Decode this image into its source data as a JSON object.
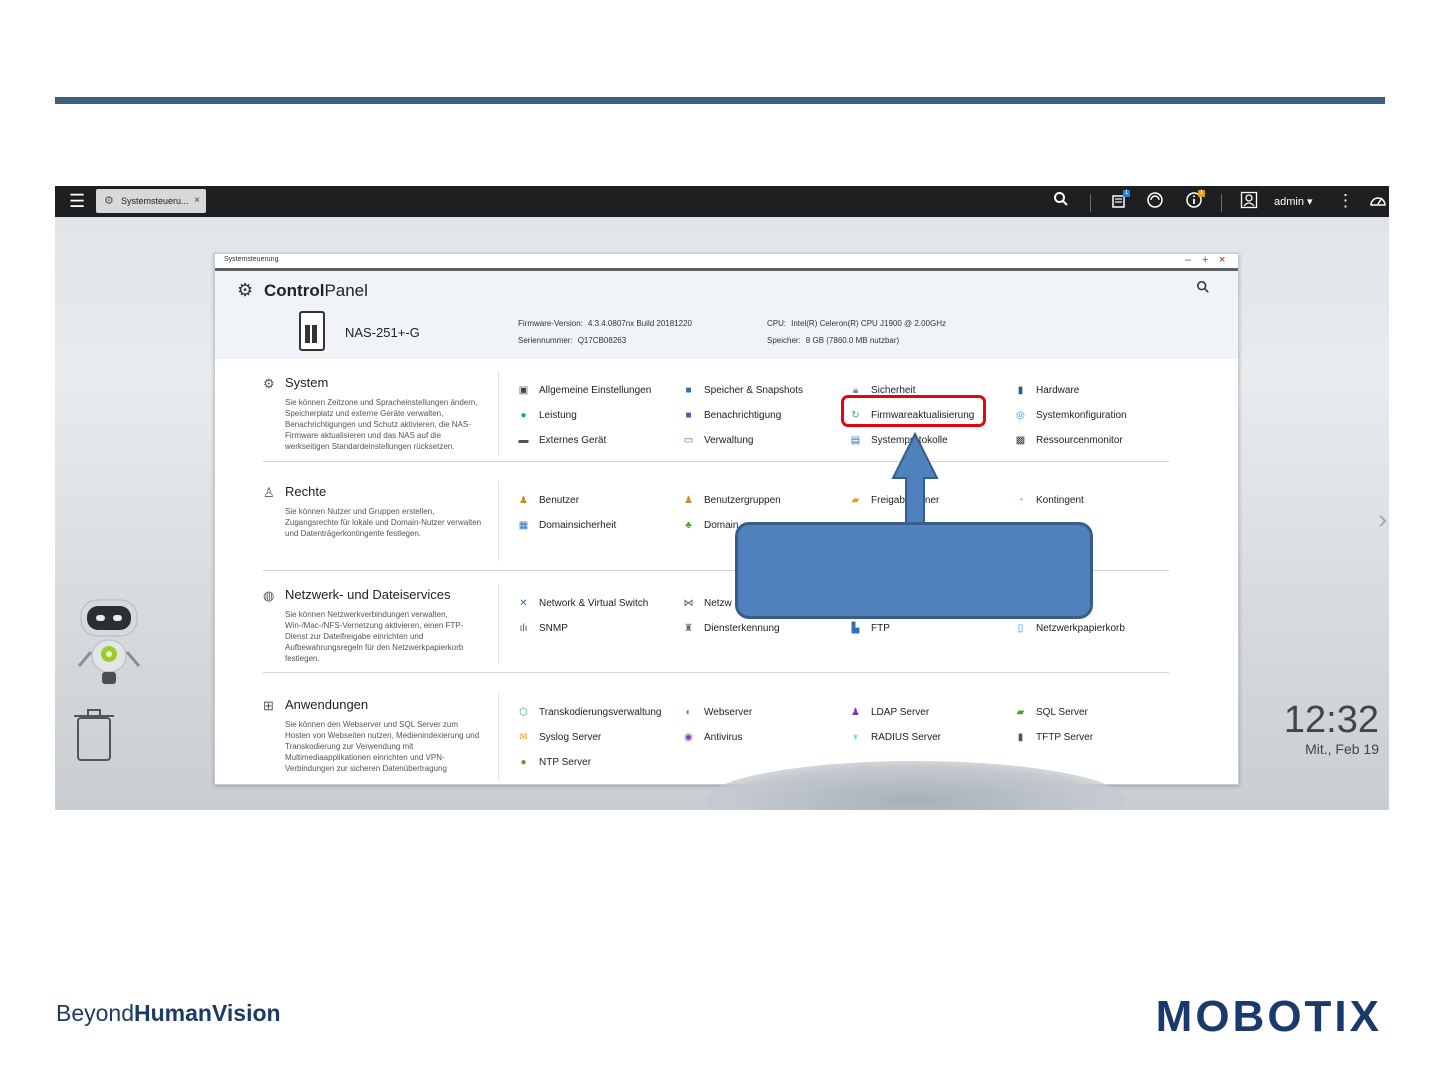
{
  "taskbar": {
    "tab_label": "Systemsteueru...",
    "tab_close": "×",
    "badge_notify": "1",
    "badge_info": "1",
    "user": "admin ▾"
  },
  "desktop": {
    "time": "12:32",
    "date": "Mit., Feb 19"
  },
  "window": {
    "title": "Systemsteuerung",
    "controls": [
      "–",
      "+",
      "×"
    ],
    "app_title_bold": "Control",
    "app_title_light": "Panel",
    "device_name": "NAS-251+-G",
    "specs": {
      "firmware_label": "Firmware-Version:",
      "firmware_value": "4.3.4.0807nx Build 20181220",
      "serial_label": "Seriennummer:",
      "serial_value": "Q17CB08263",
      "cpu_label": "CPU:",
      "cpu_value": "Intel(R) Celeron(R) CPU J1900 @ 2.00GHz",
      "memory_label": "Speicher:",
      "memory_value": "8 GB (7860.0 MB nutzbar)"
    }
  },
  "sections": [
    {
      "title": "System",
      "icon": "gear-icon",
      "description": "Sie können Zeitzone und Spracheinstellungen ändern, Speicherplatz und externe Geräte verwalten, Benachrichtigungen und Schutz aktivieren, die NAS-Firmware aktualisieren und das NAS auf die werkseitigen Standardeinstellungen rücksetzen.",
      "items": [
        {
          "label": "Allgemeine Einstellungen",
          "icon": "settings-doc-icon",
          "color": "#444"
        },
        {
          "label": "Speicher & Snapshots",
          "icon": "storage-icon",
          "color": "#2f6fb8"
        },
        {
          "label": "Sicherheit",
          "icon": "lock-icon",
          "color": "#888"
        },
        {
          "label": "Hardware",
          "icon": "hardware-icon",
          "color": "#2a5a8a"
        },
        {
          "label": "Leistung",
          "icon": "lightbulb-icon",
          "color": "#2aa07a"
        },
        {
          "label": "Benachrichtigung",
          "icon": "notification-icon",
          "color": "#7b3fb0"
        },
        {
          "label": "Firmwareaktualisierung",
          "icon": "firmware-icon",
          "color": "#3aa0a0"
        },
        {
          "label": "Systemkonfiguration",
          "icon": "system-config-icon",
          "color": "#3a8ad8"
        },
        {
          "label": "Externes Gerät",
          "icon": "external-device-icon",
          "color": "#555"
        },
        {
          "label": "Verwaltung",
          "icon": "monitor-icon",
          "color": "#2f6fb8"
        },
        {
          "label": "Systemprotokolle",
          "icon": "log-icon",
          "color": "#2f6fb8"
        },
        {
          "label": "Ressourcenmonitor",
          "icon": "resource-monitor-icon",
          "color": "#3a3a3a"
        }
      ]
    },
    {
      "title": "Rechte",
      "icon": "user-icon",
      "description": "Sie können Nutzer und Gruppen erstellen, Zugangsrechte für lokale und Domain-Nutzer verwalten und Datenträgerkontingente festlegen.",
      "items": [
        {
          "label": "Benutzer",
          "icon": "user-icon",
          "color": "#d08a2a"
        },
        {
          "label": "Benutzergruppen",
          "icon": "user-group-icon",
          "color": "#d08a2a"
        },
        {
          "label": "Freigabeordner",
          "icon": "shared-folder-icon",
          "color": "#e0a020"
        },
        {
          "label": "Kontingent",
          "icon": "quota-icon",
          "color": "#e0a020"
        },
        {
          "label": "Domainsicherheit",
          "icon": "domain-security-icon",
          "color": "#2f6fb8"
        },
        {
          "label": "Domain",
          "icon": "domain-icon",
          "color": "#5a9a2a"
        }
      ]
    },
    {
      "title": "Netzwerk- und Dateiservices",
      "icon": "network-icon",
      "description": "Sie können Netzwerkverbindungen verwalten, Win-/Mac-/NFS-Vernetzung aktivieren, einen FTP-Dienst zur Dateifreigabe einrichten und Aufbewahrungsregeln für den Netzwerkpapierkorb festlegen.",
      "items": [
        {
          "label": "Network & Virtual Switch",
          "icon": "network-switch-icon",
          "color": "#2f6fb8"
        },
        {
          "label": "Netzw",
          "icon": "network-access-icon",
          "color": "#555"
        },
        {
          "label": "SNMP",
          "icon": "snmp-icon",
          "color": "#555"
        },
        {
          "label": "Diensterkennung",
          "icon": "service-discovery-icon",
          "color": "#666"
        },
        {
          "label": "FTP",
          "icon": "ftp-icon",
          "color": "#2f6fb8"
        },
        {
          "label": "Netzwerkpapierkorb",
          "icon": "recycle-bin-icon",
          "color": "#3a8ad8"
        }
      ]
    },
    {
      "title": "Anwendungen",
      "icon": "apps-icon",
      "description": "Sie können den Webserver und SQL Server zum Hosten von Webseiten nutzen, Medienindexierung und Transkodierung zur Verwendung mit Multimediaapplikationen einrichten und VPN-Verbindungen zur sicheren Datenübertragung",
      "items": [
        {
          "label": "Transkodierungsverwaltung",
          "icon": "transcode-icon",
          "color": "#2aa07a"
        },
        {
          "label": "Webserver",
          "icon": "webserver-icon",
          "color": "#3a8ad8"
        },
        {
          "label": "LDAP Server",
          "icon": "ldap-icon",
          "color": "#7b3fb0"
        },
        {
          "label": "SQL Server",
          "icon": "sql-server-icon",
          "color": "#5a9a2a"
        },
        {
          "label": "Syslog Server",
          "icon": "syslog-icon",
          "color": "#e0a020"
        },
        {
          "label": "Antivirus",
          "icon": "antivirus-icon",
          "color": "#7b3fb0"
        },
        {
          "label": "RADIUS Server",
          "icon": "radius-icon",
          "color": "#2aa07a"
        },
        {
          "label": "TFTP Server",
          "icon": "tftp-icon",
          "color": "#555"
        },
        {
          "label": "NTP Server",
          "icon": "ntp-icon",
          "color": "#5a9a2a"
        }
      ]
    }
  ],
  "footer": {
    "tagline_light": "Beyond",
    "tagline_bold": "HumanVision",
    "brand": "MOBOTIX"
  },
  "colors": {
    "accent_rule": "#3f5f80",
    "highlight": "#e20613",
    "callout_fill": "#4f81bd",
    "brand": "#1a3a6b"
  }
}
